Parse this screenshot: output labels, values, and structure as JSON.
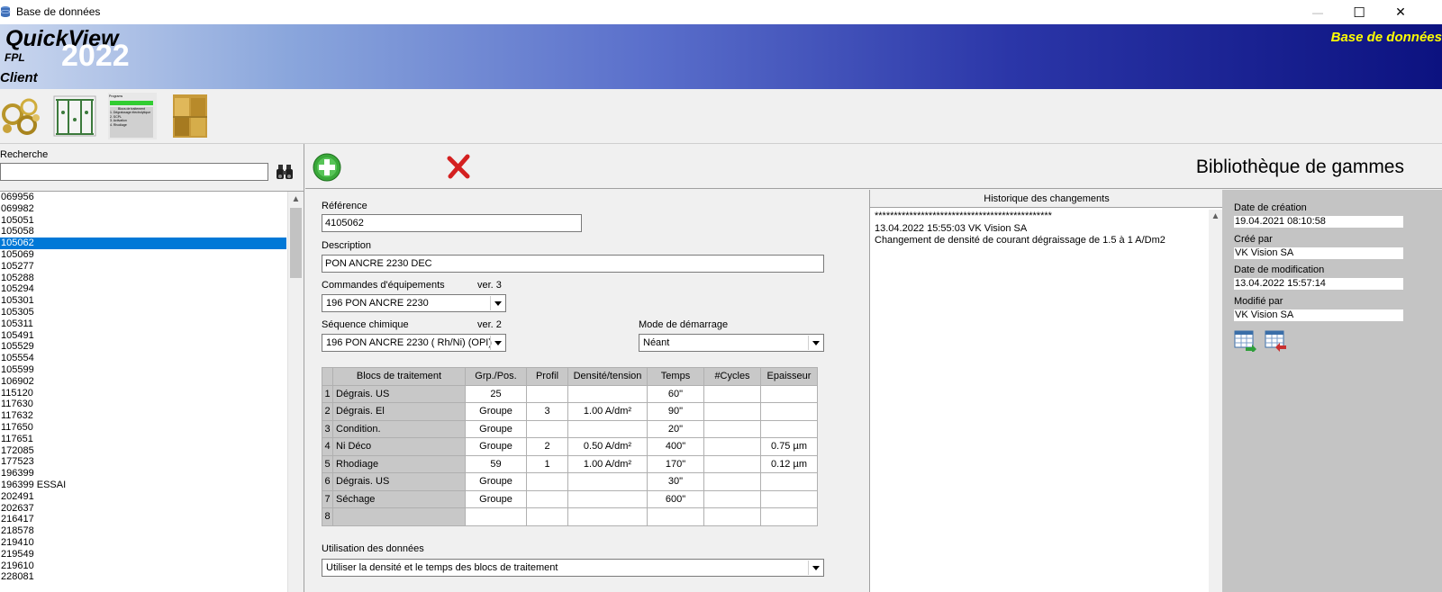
{
  "window": {
    "title": "Base de données",
    "minimize": "—",
    "maximize": "☐",
    "close": "✕"
  },
  "banner": {
    "product": "QuickView",
    "edition": "FPL",
    "year": "2022",
    "mode": "Client",
    "module": "Base de données"
  },
  "toolbar": {
    "tools": [
      {
        "name": "parts-tool-icon"
      },
      {
        "name": "rack-tool-icon"
      },
      {
        "name": "program-tool-icon"
      },
      {
        "name": "archive-tool-icon"
      }
    ],
    "program_thumb": {
      "header": "Programs",
      "items": [
        "Blocs de traitement",
        "1. Dégraissage électrolytique",
        "2. SCPL",
        "3. Activation",
        "4. Rhodiage"
      ]
    }
  },
  "search": {
    "label": "Recherche",
    "value": ""
  },
  "list": {
    "items": [
      "069956",
      "069982",
      "105051",
      "105058",
      "105062",
      "105069",
      "105277",
      "105288",
      "105294",
      "105301",
      "105305",
      "105311",
      "105491",
      "105529",
      "105554",
      "105599",
      "106902",
      "115120",
      "117630",
      "117632",
      "117650",
      "117651",
      "172085",
      "177523",
      "196399",
      "196399 ESSAI",
      "202491",
      "202637",
      "216417",
      "218578",
      "219410",
      "219549",
      "219610",
      "228081"
    ],
    "selected": "105062"
  },
  "main": {
    "title": "Bibliothèque de gammes"
  },
  "form": {
    "reference_label": "Référence",
    "reference_value": "4105062",
    "description_label": "Description",
    "description_value": "PON ANCRE 2230 DEC",
    "equipment_label": "Commandes d'équipements",
    "equipment_version": "ver. 3",
    "equipment_value": "196 PON ANCRE 2230",
    "chem_label": "Séquence chimique",
    "chem_version": "ver. 2",
    "chem_value": "196 PON ANCRE 2230  ( Rh/Ni) (OPI)",
    "start_label": "Mode de démarrage",
    "start_value": "Néant",
    "usage_label": "Utilisation des données",
    "usage_value": "Utiliser la densité et le temps des blocs de traitement"
  },
  "grid": {
    "headers": [
      "Blocs de traitement",
      "Grp./Pos.",
      "Profil",
      "Densité/tension",
      "Temps",
      "#Cycles",
      "Epaisseur"
    ],
    "rows": [
      {
        "n": "1",
        "block": "Dégrais. US",
        "grp": "25",
        "profil": "",
        "density": "",
        "time": "60\"",
        "cycles": "",
        "thick": ""
      },
      {
        "n": "2",
        "block": "Dégrais. El",
        "grp": "Groupe",
        "profil": "3",
        "density": "1.00 A/dm²",
        "time": "90\"",
        "cycles": "",
        "thick": ""
      },
      {
        "n": "3",
        "block": "Condition.",
        "grp": "Groupe",
        "profil": "",
        "density": "",
        "time": "20\"",
        "cycles": "",
        "thick": ""
      },
      {
        "n": "4",
        "block": "Ni Déco",
        "grp": "Groupe",
        "profil": "2",
        "density": "0.50 A/dm²",
        "time": "400\"",
        "cycles": "",
        "thick": "0.75 µm"
      },
      {
        "n": "5",
        "block": "Rhodiage",
        "grp": "59",
        "profil": "1",
        "density": "1.00 A/dm²",
        "time": "170\"",
        "cycles": "",
        "thick": "0.12 µm"
      },
      {
        "n": "6",
        "block": "Dégrais. US",
        "grp": "Groupe",
        "profil": "",
        "density": "",
        "time": "30\"",
        "cycles": "",
        "thick": ""
      },
      {
        "n": "7",
        "block": "Séchage",
        "grp": "Groupe",
        "profil": "",
        "density": "",
        "time": "600\"",
        "cycles": "",
        "thick": ""
      },
      {
        "n": "8",
        "block": "",
        "grp": "",
        "profil": "",
        "density": "",
        "time": "",
        "cycles": "",
        "thick": ""
      }
    ]
  },
  "history": {
    "title": "Historique des changements",
    "lines": [
      "**********************************************",
      "13.04.2022 15:55:03  VK Vision SA",
      "Changement de densité de courant dégraissage de 1.5 à 1 A/Dm2"
    ]
  },
  "meta": {
    "created_label": "Date de création",
    "created_value": "19.04.2021 08:10:58",
    "created_by_label": "Créé par",
    "created_by_value": "VK Vision SA",
    "modified_label": "Date de modification",
    "modified_value": "13.04.2022 15:57:14",
    "modified_by_label": "Modifié par",
    "modified_by_value": "VK Vision SA"
  },
  "colors": {
    "selection": "#0078d7",
    "banner_end": "#0c1280",
    "module_text": "#ffff00",
    "add": "#3aa83a",
    "delete": "#d42020"
  }
}
